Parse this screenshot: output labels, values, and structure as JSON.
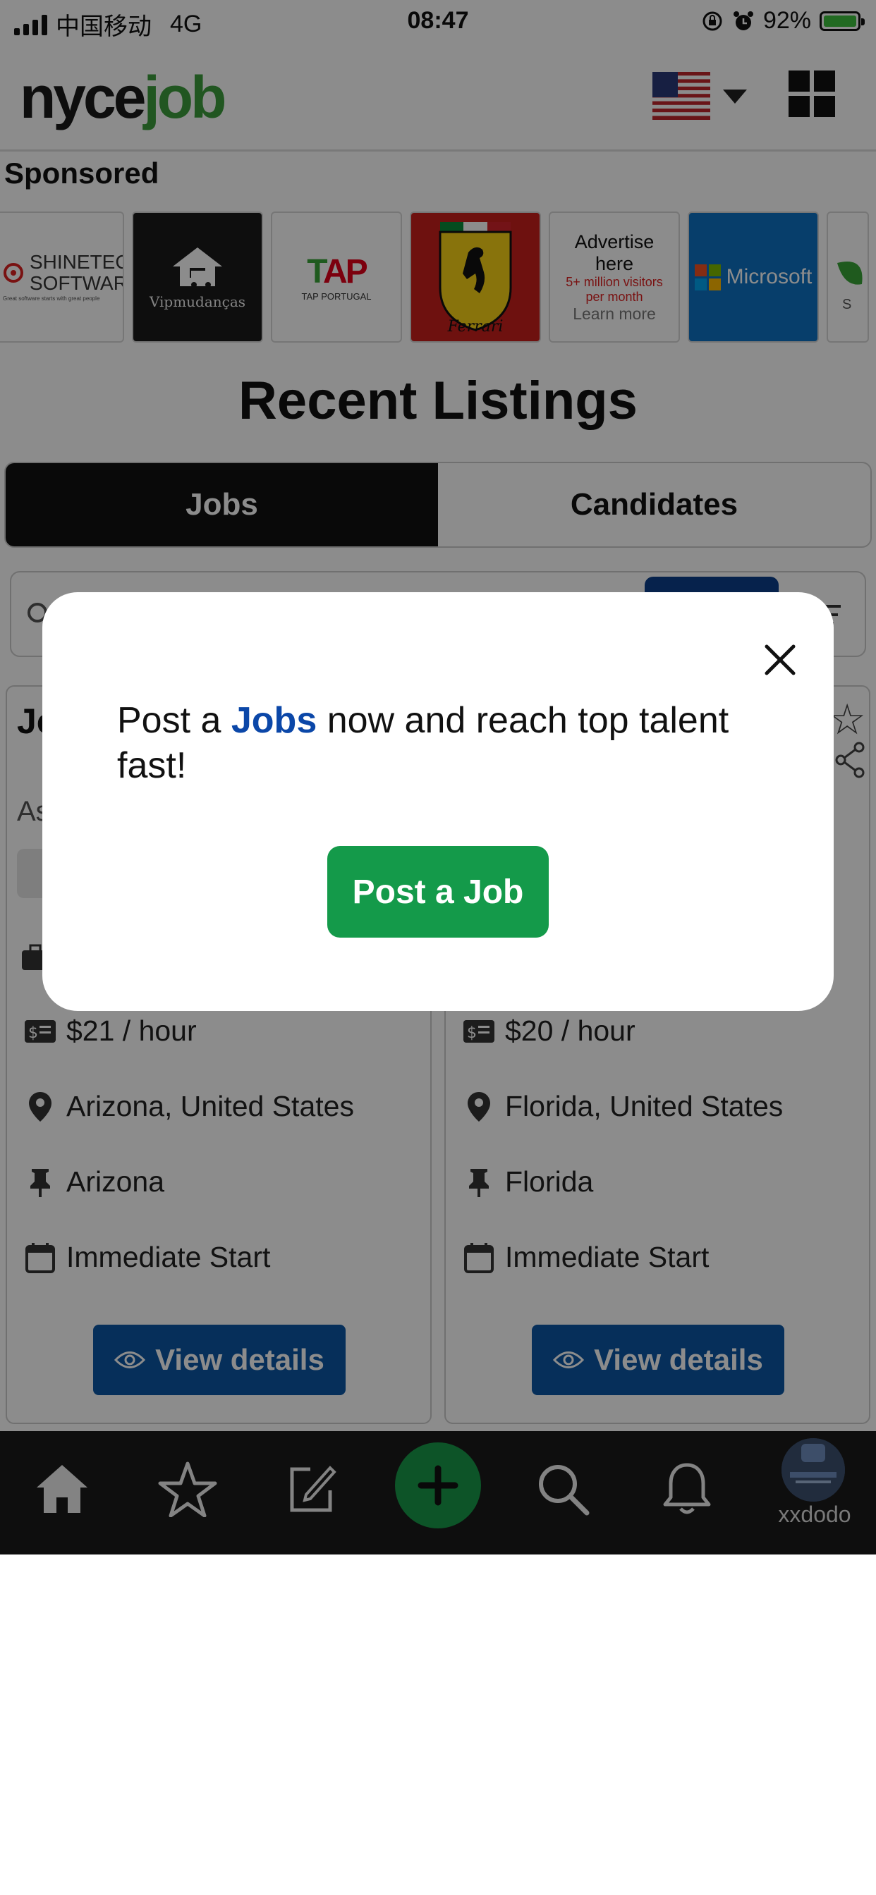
{
  "status_bar": {
    "carrier": "中国移动",
    "network": "4G",
    "time": "08:47",
    "battery": "92%"
  },
  "header": {
    "logo_part1": "nyce",
    "logo_part2": "job",
    "flag_icon": "us-flag-icon",
    "menu_icon": "grid-menu-icon"
  },
  "sponsored": {
    "label": "Sponsored",
    "items": [
      {
        "name": "SHINETECH",
        "name2": "SOFTWARE",
        "tagline": "Great software starts with great people"
      },
      {
        "name": "Vipmudanças"
      },
      {
        "name": "TAP",
        "sub": "TAP PORTUGAL"
      },
      {
        "name": "Ferrari"
      },
      {
        "line1": "Advertise",
        "line2": "here",
        "line3": "5+ million visitors",
        "line4": "per month",
        "line5": "Learn more"
      },
      {
        "name": "Microsoft"
      },
      {
        "name": "S"
      }
    ]
  },
  "listings": {
    "title": "Recent Listings",
    "tabs": [
      "Jobs",
      "Candidates"
    ],
    "active_tab": "Jobs"
  },
  "cards": [
    {
      "title": "Jo",
      "subtitle": "As",
      "salary": "$21 / hour",
      "location": "Arizona, United States",
      "region": "Arizona",
      "start": "Immediate Start",
      "button": "View details"
    },
    {
      "salary": "$20 / hour",
      "location": "Florida, United States",
      "region": "Florida",
      "start": "Immediate Start",
      "button": "View details"
    }
  ],
  "bottom_nav": {
    "user": "xxdodo"
  },
  "modal": {
    "text_pre": "Post a ",
    "text_highlight": "Jobs",
    "text_post": " now and reach top talent fast!",
    "button": "Post a Job"
  },
  "colors": {
    "brand_green": "#149a4a",
    "brand_blue": "#0b47a8",
    "button_blue": "#0b57a4"
  }
}
